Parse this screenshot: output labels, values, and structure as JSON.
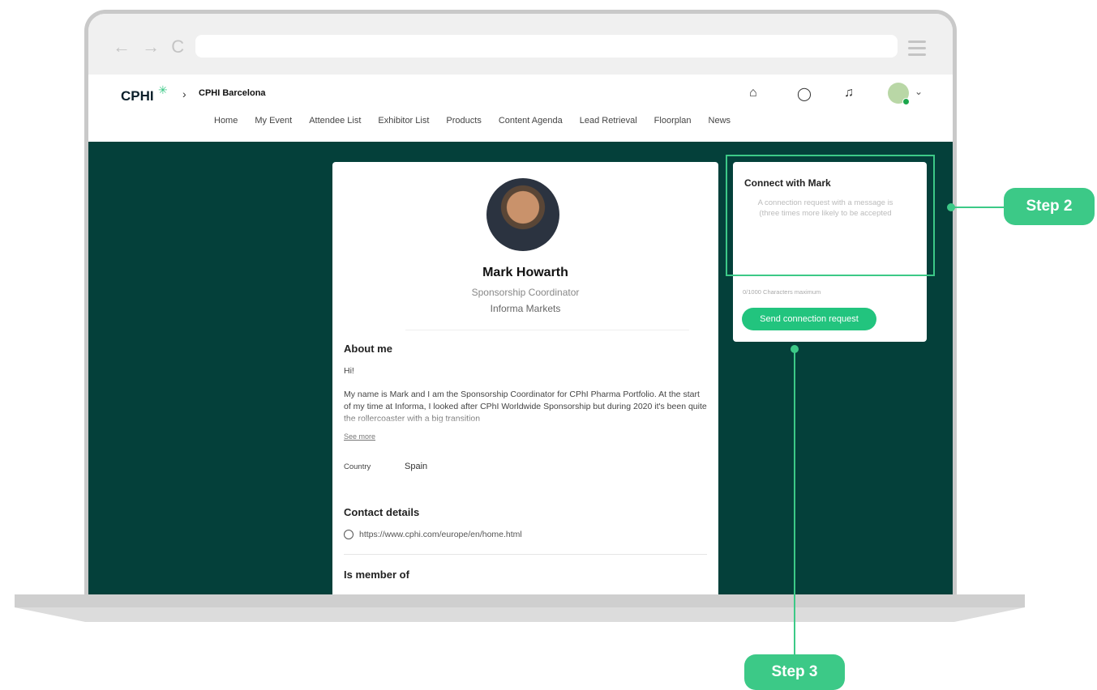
{
  "browser": {
    "nav_arrows": "← → C"
  },
  "header": {
    "logo": "CPHI",
    "breadcrumb": "CPHI Barcelona",
    "icons": [
      "home-icon",
      "chat-icon",
      "bell-icon"
    ]
  },
  "nav": {
    "items": [
      "Home",
      "My Event",
      "Attendee List",
      "Exhibitor List",
      "Products",
      "Content Agenda",
      "Lead Retrieval",
      "Floorplan",
      "News"
    ]
  },
  "profile": {
    "name": "Mark Howarth",
    "role": "Sponsorship Coordinator",
    "company": "Informa Markets",
    "about_title": "About me",
    "about_greeting": "Hi!",
    "about_text": "My name is Mark and I am the Sponsorship Coordinator for CPhI Pharma Portfolio. At the start of my time at Informa, I looked after CPhI Worldwide Sponsorship but during 2020 it's been quite the rollercoaster with a big transition",
    "see_more": "See more",
    "country_label": "Country",
    "country_value": "Spain",
    "contact_title": "Contact details",
    "website": "https://www.cphi.com/europe/en/home.html",
    "member_title": "Is member of"
  },
  "connect": {
    "title": "Connect with Mark",
    "placeholder": "A connection request with a message is (three times more likely to be accepted",
    "char_limit": "0/1000 Characters maximum",
    "button": "Send connection request"
  },
  "callouts": {
    "step2": "Step 2",
    "step3": "Step 3"
  },
  "colors": {
    "accent": "#3cc987",
    "background": "#04403a",
    "button": "#22c47e"
  }
}
